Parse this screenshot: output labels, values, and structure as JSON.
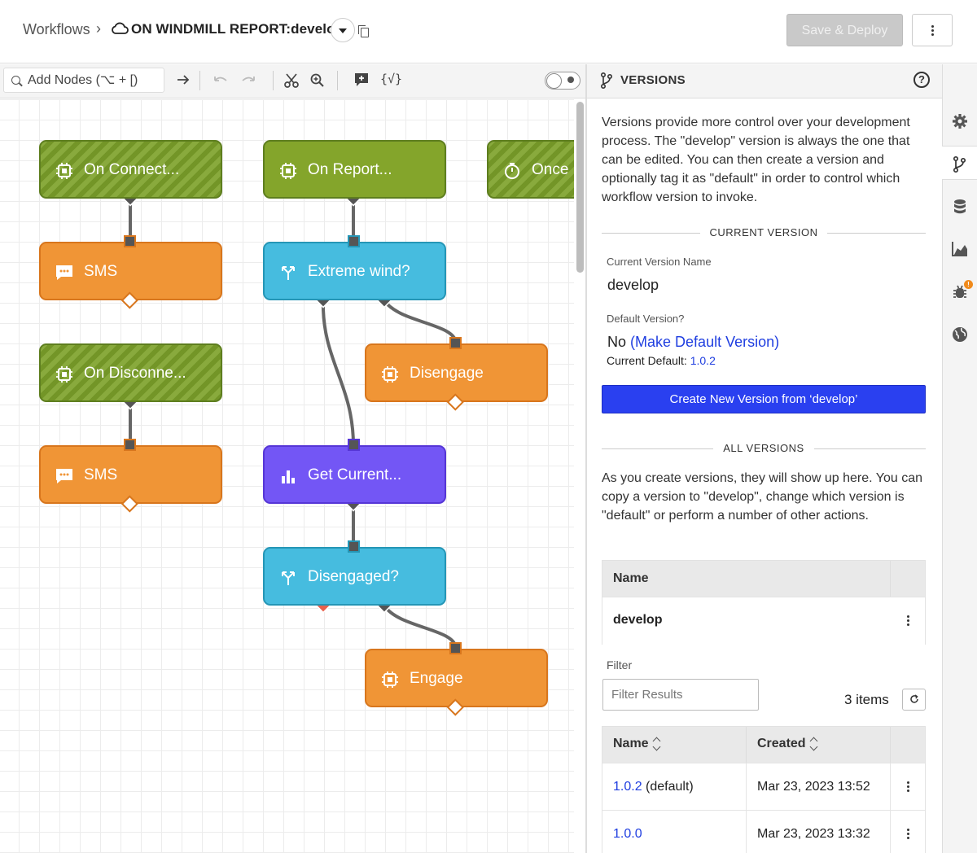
{
  "header": {
    "breadcrumb": "Workflows",
    "separator": "›",
    "workflow_title": "ON WINDMILL REPORT:develop",
    "save_label": "Save & Deploy"
  },
  "toolbar": {
    "add_nodes": "Add Nodes (⌥ + [)",
    "icons": [
      "arrow-right-icon",
      "undo-icon",
      "redo-icon",
      "scissors-icon",
      "zoom-icon",
      "add-comment-icon",
      "json-icon"
    ],
    "json_glyph": "{√}"
  },
  "canvas": {
    "nodes": [
      {
        "id": "on-connect",
        "label": "On Connect...",
        "kind": "trigger",
        "icon": "cpu-icon"
      },
      {
        "id": "sms-1",
        "label": "SMS",
        "kind": "orange",
        "icon": "message-icon"
      },
      {
        "id": "on-disconnect",
        "label": "On Disconne...",
        "kind": "trigger",
        "icon": "cpu-icon"
      },
      {
        "id": "sms-2",
        "label": "SMS",
        "kind": "orange",
        "icon": "message-icon"
      },
      {
        "id": "on-report",
        "label": "On Report...",
        "kind": "trigger-solid",
        "icon": "cpu-icon"
      },
      {
        "id": "extreme-wind",
        "label": "Extreme wind?",
        "kind": "teal",
        "icon": "branch-icon"
      },
      {
        "id": "disengage",
        "label": "Disengage",
        "kind": "orange",
        "icon": "cpu-icon"
      },
      {
        "id": "get-current",
        "label": "Get Current...",
        "kind": "purple",
        "icon": "bar-chart-icon"
      },
      {
        "id": "disengaged",
        "label": "Disengaged?",
        "kind": "teal",
        "icon": "branch-icon"
      },
      {
        "id": "engage",
        "label": "Engage",
        "kind": "orange",
        "icon": "cpu-icon"
      },
      {
        "id": "once",
        "label": "Once",
        "kind": "trigger",
        "icon": "timer-icon"
      }
    ]
  },
  "versions": {
    "title": "VERSIONS",
    "intro": "Versions provide more control over your development process. The \"develop\" version is always the one that can be edited. You can then create a version and optionally tag it as \"default\" in order to control which workflow version to invoke.",
    "current_section": "CURRENT VERSION",
    "current_name_label": "Current Version Name",
    "current_name": "develop",
    "default_label": "Default Version?",
    "default_value": "No",
    "make_default_link": "(Make Default Version)",
    "current_default_label": "Current Default:",
    "current_default_value": "1.0.2",
    "create_button": "Create New Version from ‘develop’",
    "all_section": "ALL VERSIONS",
    "all_intro": "As you create versions, they will show up here. You can copy a version to \"develop\", change which version is \"default\" or perform a number of other actions.",
    "develop_table": {
      "header": "Name",
      "row": "develop"
    },
    "filter_label": "Filter",
    "filter_placeholder": "Filter Results",
    "items_count": "3 items",
    "table": {
      "columns": [
        "Name",
        "Created"
      ],
      "rows": [
        {
          "name": "1.0.2",
          "tag": "(default)",
          "created": "Mar 23, 2023 13:52"
        },
        {
          "name": "1.0.0",
          "tag": "",
          "created": "Mar 23, 2023 13:32"
        }
      ]
    }
  },
  "rail": {
    "items": [
      "settings-icon",
      "versions-icon",
      "storage-icon",
      "stats-icon",
      "debug-icon",
      "globe-icon"
    ],
    "badge": "!"
  },
  "colors": {
    "trigger": "#7da22a",
    "orange": "#f09536",
    "teal": "#46bcdf",
    "purple": "#7356f5",
    "primary": "#2a40f0",
    "link": "#1f3ee0"
  }
}
